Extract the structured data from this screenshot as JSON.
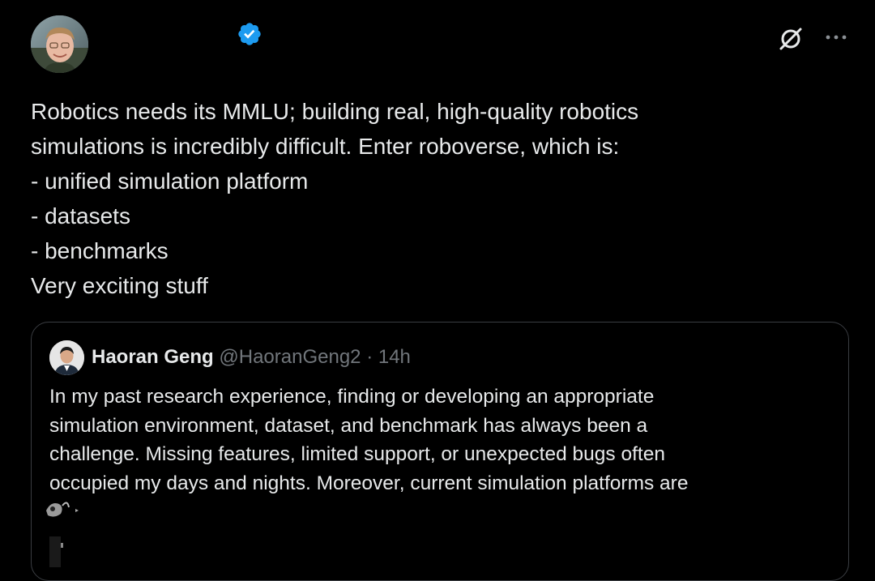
{
  "tweet": {
    "author_avatar_icon": "profile-avatar",
    "verified_icon": "verified-badge-icon",
    "grok_icon": "grok-icon",
    "more_icon": "more-options-icon",
    "text_lines": [
      "Robotics needs its MMLU; building real, high-quality robotics",
      "simulations is incredibly difficult. Enter roboverse, which is:",
      "- unified simulation platform",
      "- datasets",
      "- benchmarks",
      "Very exciting stuff"
    ]
  },
  "quoted_tweet": {
    "name": "Haoran Geng",
    "handle": "@HaoranGeng2",
    "separator": "·",
    "time": "14h",
    "text_lines": [
      "In my past research experience, finding or developing an appropriate",
      "simulation environment, dataset, and benchmark has always been a",
      "challenge. Missing features, limited support, or unexpected bugs often",
      "occupied my days and nights. Moreover, current simulation platforms are"
    ]
  },
  "colors": {
    "background": "#000000",
    "text_primary": "#e7e9ea",
    "text_secondary": "#71767b",
    "verified_blue": "#1d9bf0",
    "border": "#3a3d42"
  }
}
